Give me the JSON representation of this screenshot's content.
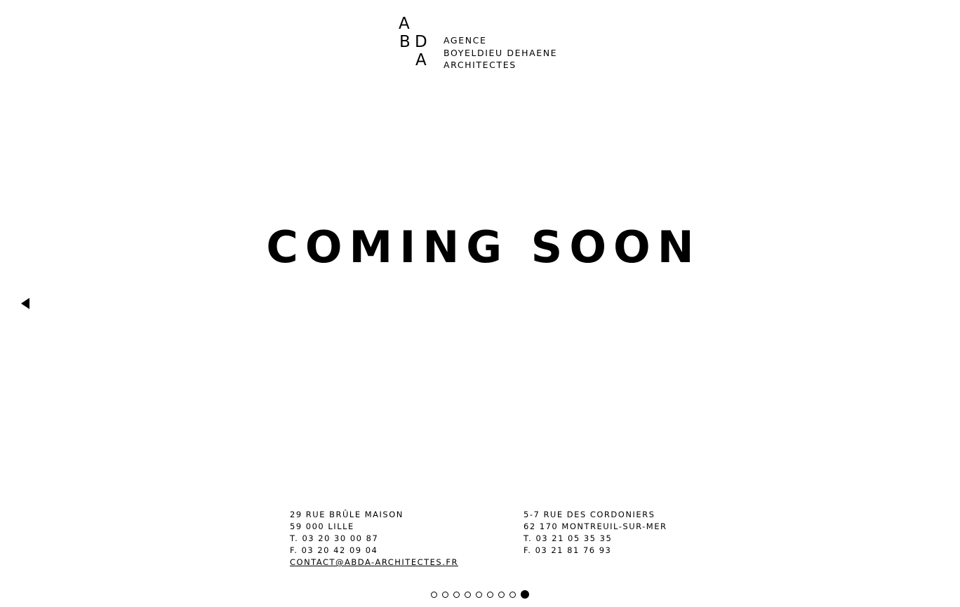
{
  "logo": {
    "mark": {
      "a1": "A",
      "b": "B",
      "d": "D",
      "a2": "A"
    },
    "lines": [
      "AGENCE",
      "BOYELDIEU DEHAENE",
      "ARCHITECTES"
    ]
  },
  "headline": "COMING SOON",
  "navigation": {
    "prev_icon": "triangle-left-icon"
  },
  "offices": [
    {
      "street": "29 RUE BRÛLE MAISON",
      "city": "59 000 LILLE",
      "phone": "T. 03 20 30 00 87",
      "fax": "F. 03 20 42 09 04",
      "email": "CONTACT@ABDA-ARCHITECTES.FR"
    },
    {
      "street": "5-7 RUE DES CORDONIERS",
      "city": "62 170 MONTREUIL-SUR-MER",
      "phone": "T. 03 21 05 35 35",
      "fax": "F. 03 21 81 76 93"
    }
  ],
  "pager": {
    "total": 9,
    "active_index": 8
  }
}
